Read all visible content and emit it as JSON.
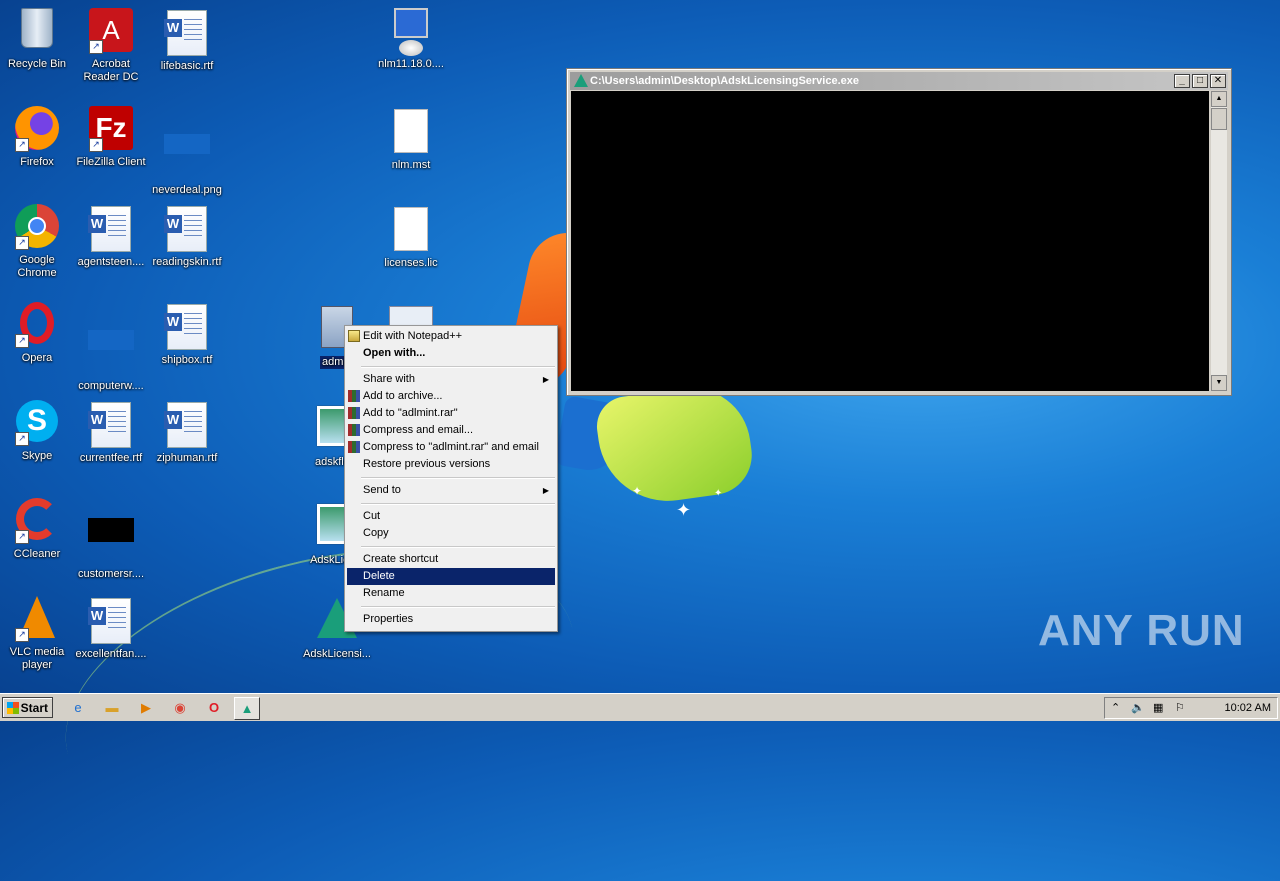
{
  "desktop": {
    "icons": [
      {
        "label": "Recycle Bin",
        "icon": "recycle-bin-icon"
      },
      {
        "label": "Acrobat Reader DC",
        "icon": "acrobat-icon"
      },
      {
        "label": "lifebasic.rtf",
        "icon": "word-doc-icon"
      },
      {
        "label": "nlm11.18.0....",
        "icon": "installer-icon"
      },
      {
        "label": "Firefox",
        "icon": "firefox-icon"
      },
      {
        "label": "FileZilla Client",
        "icon": "filezilla-icon"
      },
      {
        "label": "neverdeal.png",
        "icon": "image-icon"
      },
      {
        "label": "nlm.mst",
        "icon": "blank-file-icon"
      },
      {
        "label": "Google Chrome",
        "icon": "chrome-icon"
      },
      {
        "label": "agentsteen....",
        "icon": "word-doc-icon"
      },
      {
        "label": "readingskin.rtf",
        "icon": "word-doc-icon"
      },
      {
        "label": "licenses.lic",
        "icon": "blank-file-icon"
      },
      {
        "label": "Opera",
        "icon": "opera-icon"
      },
      {
        "label": "computerw....",
        "icon": "image-icon"
      },
      {
        "label": "shipbox.rtf",
        "icon": "word-doc-icon"
      },
      {
        "label": "admin",
        "icon": "config-file-icon"
      },
      {
        "label": "Skype",
        "icon": "skype-icon"
      },
      {
        "label": "currentfee.rtf",
        "icon": "word-doc-icon"
      },
      {
        "label": "ziphuman.rtf",
        "icon": "word-doc-icon"
      },
      {
        "label": "adskfle...",
        "icon": "image-file-icon"
      },
      {
        "label": "CCleaner",
        "icon": "ccleaner-icon"
      },
      {
        "label": "customersr....",
        "icon": "black-image-icon"
      },
      {
        "label": "AdskLice...",
        "icon": "image-file-icon"
      },
      {
        "label": "VLC media player",
        "icon": "vlc-icon"
      },
      {
        "label": "excellentfan....",
        "icon": "word-doc-icon"
      },
      {
        "label": "AdskLicensi...",
        "icon": "autodesk-icon"
      }
    ]
  },
  "console": {
    "title": "C:\\Users\\admin\\Desktop\\AdskLicensingService.exe",
    "btn_min": "_",
    "btn_max": "□",
    "btn_close": "✕"
  },
  "context_menu": {
    "edit_notepad": "Edit with Notepad++",
    "open_with": "Open with...",
    "share_with": "Share with",
    "add_archive": "Add to archive...",
    "add_rar": "Add to \"adlmint.rar\"",
    "compress_email": "Compress and email...",
    "compress_rar_email": "Compress to \"adlmint.rar\" and email",
    "restore": "Restore previous versions",
    "send_to": "Send to",
    "cut": "Cut",
    "copy": "Copy",
    "create_shortcut": "Create shortcut",
    "delete": "Delete",
    "rename": "Rename",
    "properties": "Properties"
  },
  "taskbar": {
    "start_label": "Start",
    "clock": "10:02 AM"
  },
  "watermark": "ANY  RUN"
}
